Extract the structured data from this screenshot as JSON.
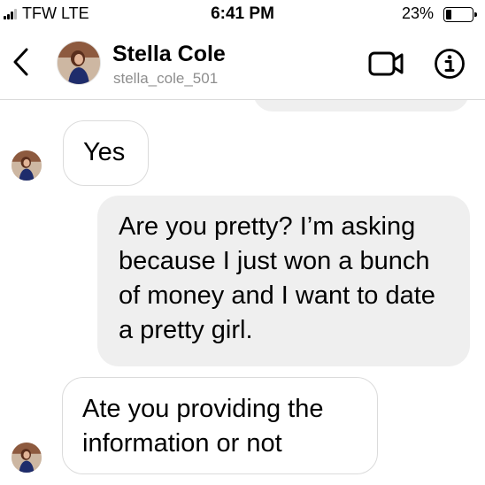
{
  "status_bar": {
    "carrier": "TFW  LTE",
    "time": "6:41 PM",
    "battery_percent": "23%",
    "battery_level": 0.23
  },
  "header": {
    "back_icon": "chevron-left-icon",
    "contact_name": "Stella Cole",
    "contact_username": "stella_cole_501",
    "video_icon": "video-camera-icon",
    "info_icon": "info-icon"
  },
  "messages": [
    {
      "sender": "contact",
      "text": "Yes"
    },
    {
      "sender": "me",
      "text": "Are you pretty?  I’m asking because I just won a bunch of money and I want to date a pretty girl."
    },
    {
      "sender": "contact",
      "text": "Ate you providing the information or not"
    }
  ],
  "colors": {
    "outgoing_bubble": "#efefef",
    "incoming_border": "#dbdbdb",
    "muted_text": "#8e8e8e"
  }
}
